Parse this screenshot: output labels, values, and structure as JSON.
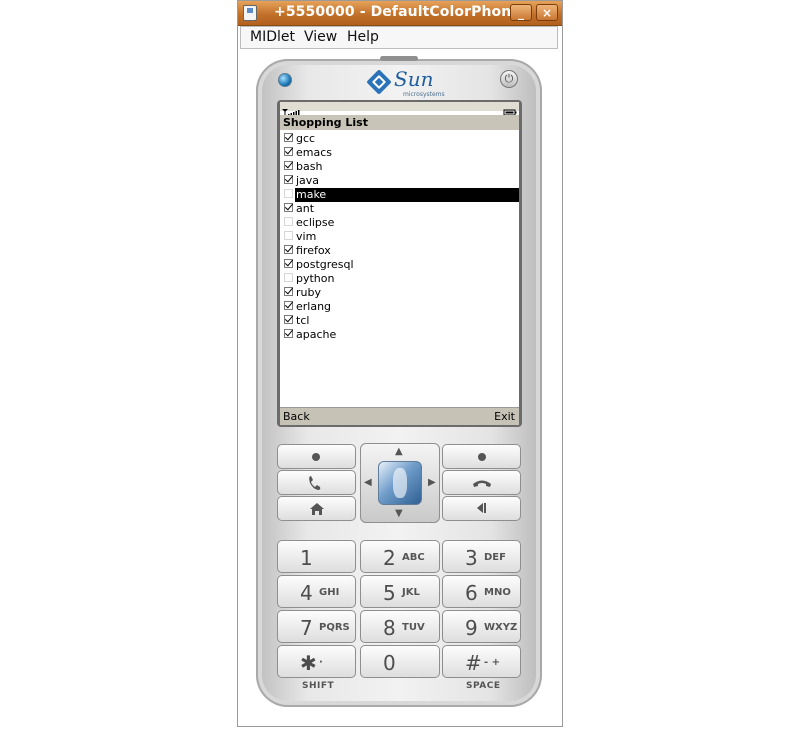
{
  "window": {
    "title": "+5550000 - DefaultColorPhone",
    "minimize_glyph": "_",
    "close_glyph": "×"
  },
  "menubar": {
    "items": [
      "MIDlet",
      "View",
      "Help"
    ]
  },
  "phone": {
    "brand": "Sun",
    "brand_sub": "microsystems",
    "screen": {
      "title": "Shopping List",
      "items": [
        {
          "label": "gcc",
          "checked": true
        },
        {
          "label": "emacs",
          "checked": true
        },
        {
          "label": "bash",
          "checked": true
        },
        {
          "label": "java",
          "checked": true
        },
        {
          "label": "make",
          "checked": false,
          "selected": true
        },
        {
          "label": "ant",
          "checked": true
        },
        {
          "label": "eclipse",
          "checked": false
        },
        {
          "label": "vim",
          "checked": false
        },
        {
          "label": "firefox",
          "checked": true
        },
        {
          "label": "postgresql",
          "checked": true
        },
        {
          "label": "python",
          "checked": false
        },
        {
          "label": "ruby",
          "checked": true
        },
        {
          "label": "erlang",
          "checked": true
        },
        {
          "label": "tcl",
          "checked": true
        },
        {
          "label": "apache",
          "checked": true
        }
      ],
      "soft_left": "Back",
      "soft_right": "Exit"
    },
    "keys": {
      "k1": {
        "digit": "1",
        "letters": ""
      },
      "k2": {
        "digit": "2",
        "letters": "ABC"
      },
      "k3": {
        "digit": "3",
        "letters": "DEF"
      },
      "k4": {
        "digit": "4",
        "letters": "GHI"
      },
      "k5": {
        "digit": "5",
        "letters": "JKL"
      },
      "k6": {
        "digit": "6",
        "letters": "MNO"
      },
      "k7": {
        "digit": "7",
        "letters": "PQRS"
      },
      "k8": {
        "digit": "8",
        "letters": "TUV"
      },
      "k9": {
        "digit": "9",
        "letters": "WXYZ"
      },
      "kstar": {
        "digit": "✱",
        "letters": "·"
      },
      "k0": {
        "digit": "0",
        "letters": ""
      },
      "khash": {
        "digit": "#",
        "letters": "- +"
      }
    },
    "shift_label": "SHIFT",
    "space_label": "SPACE"
  }
}
